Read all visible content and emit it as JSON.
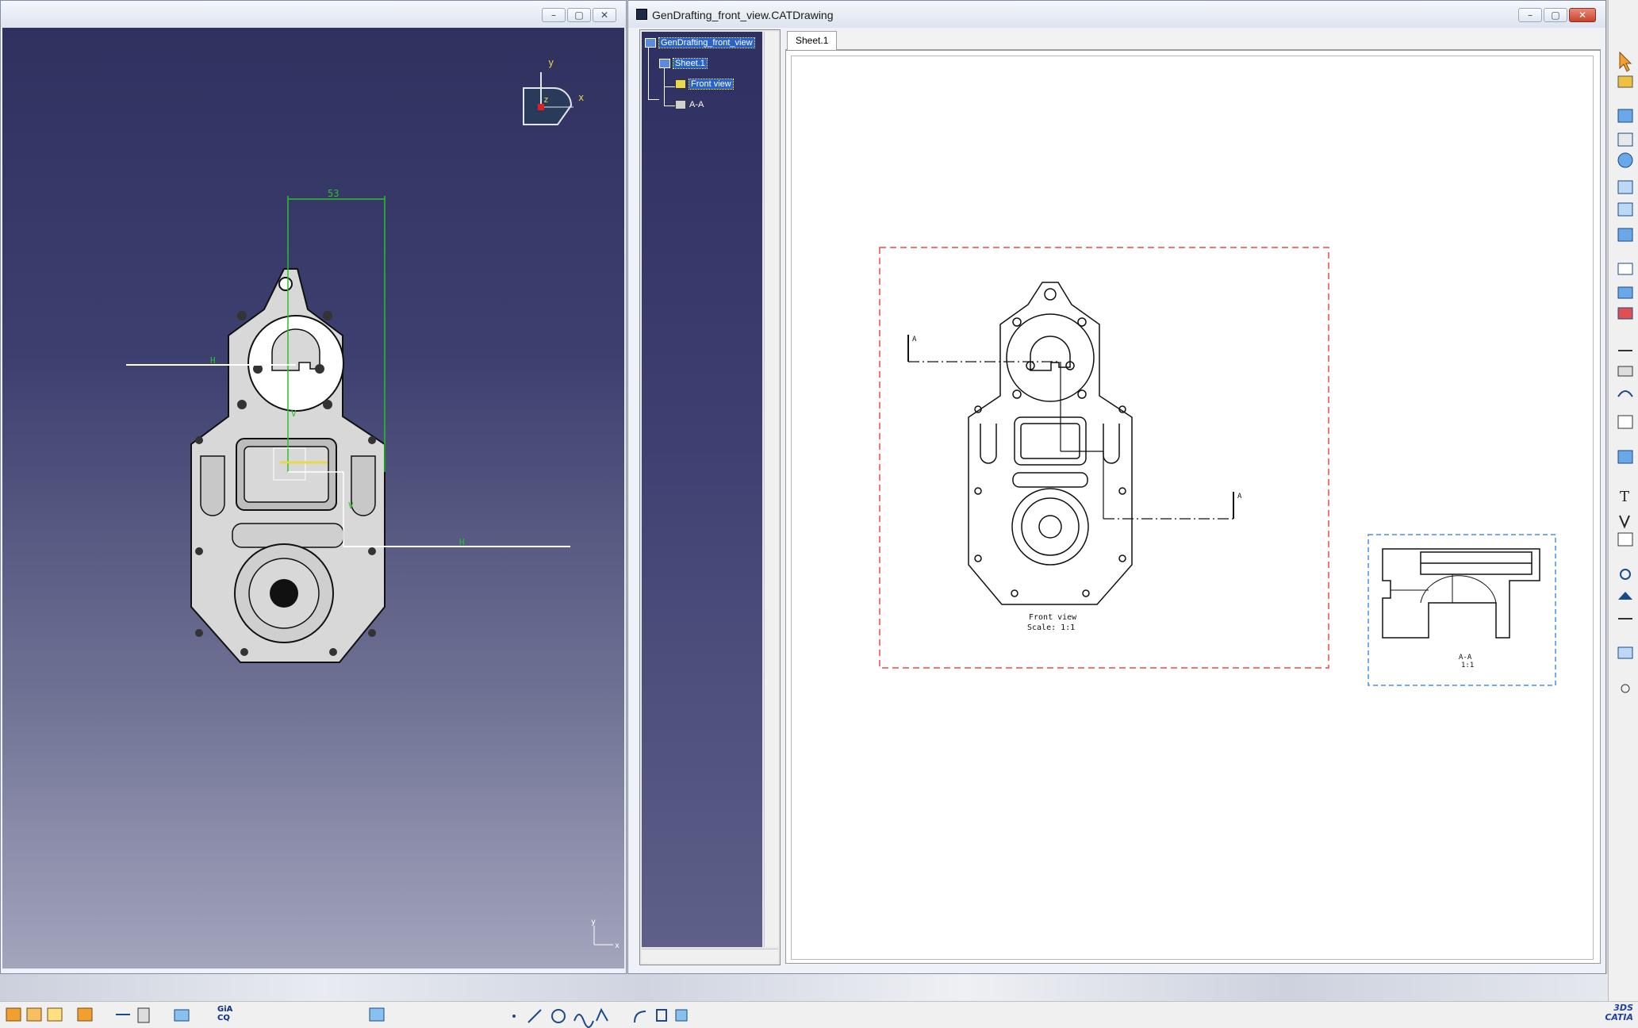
{
  "left_window": {
    "axis_labels": {
      "x": "x",
      "y": "y",
      "z": "z"
    },
    "dimension_value": "53",
    "constraint_marks": {
      "h1": "H",
      "h2": "H",
      "v1": "V",
      "v2": "V"
    },
    "corner_axes": {
      "x": "x",
      "y": "y"
    },
    "buttons": {
      "minimize": "–",
      "restore": "▢",
      "close": "✕"
    }
  },
  "drawing_window": {
    "title": "GenDrafting_front_view.CATDrawing",
    "buttons": {
      "minimize": "–",
      "restore": "▢",
      "close": "✕"
    },
    "tree": {
      "root": "GenDrafting_front_view",
      "sheet": "Sheet.1",
      "views": [
        "Front view",
        "A-A"
      ]
    },
    "tabs": [
      "Sheet.1"
    ],
    "sheet": {
      "front_view_caption": "Front view",
      "front_view_scale": "Scale:  1:1",
      "section_marker": "A",
      "section_view_caption": "A-A",
      "section_view_scale": "1:1"
    }
  },
  "bottom_bar": {
    "gia_label_top": "GiA",
    "gia_label_bottom": "CQ",
    "brand": "3DS",
    "brand_sub": "CATIA"
  },
  "colors": {
    "viewport_top": "#30315f",
    "viewport_bottom": "#a3a5bd",
    "part_fill": "#d8d8d8",
    "dimension_green": "#27c227",
    "front_view_frame": "#e84a4a",
    "section_view_frame": "#4a8de0"
  }
}
